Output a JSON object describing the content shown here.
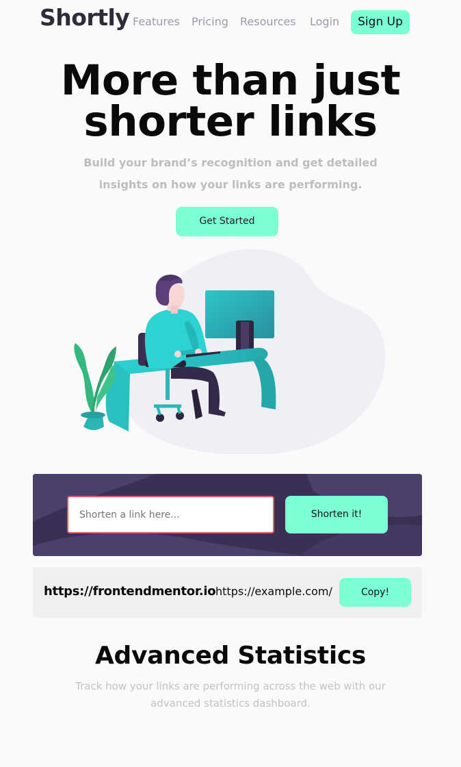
{
  "nav": {
    "logo": "Shortly",
    "links": [
      "Features",
      "Pricing",
      "Resources",
      "Login"
    ],
    "signup": "Sign Up"
  },
  "hero": {
    "title_line1": "More than just",
    "title_line2": "shorter links",
    "subtitle": "Build your brand’s recognition and get detailed insights on how your links are performing.",
    "cta": "Get Started"
  },
  "shorten": {
    "placeholder": "Shorten a link here...",
    "button": "Shorten it!"
  },
  "result": {
    "original": "https://frontendmentor.io",
    "short": "https://example.com/",
    "copy": "Copy!"
  },
  "stats": {
    "title": "Advanced Statistics",
    "subtitle": "Track how your links are performing across the web with our advanced statistics dashboard."
  },
  "colors": {
    "accent": "#7dffd4",
    "dark_violet": "#3b3054",
    "error_red": "#e35a63",
    "gray_text": "#9e9aa8"
  }
}
